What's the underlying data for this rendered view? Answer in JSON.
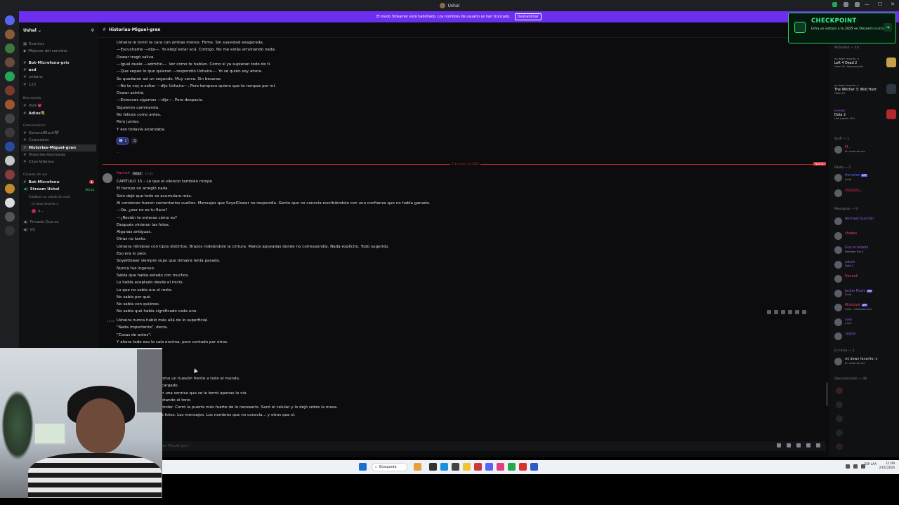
{
  "window": {
    "title": "Ushal"
  },
  "banner": {
    "text": "El modo Streamer está habilitado. Los nombres de usuario se han truncado.",
    "button": "Deshabilitar"
  },
  "server": {
    "name": "Ushal",
    "chevron": "⌄"
  },
  "sidebar": {
    "items": [
      {
        "label": "Eventos",
        "type": "link"
      },
      {
        "label": "Mejoras del servidor",
        "type": "link"
      },
      {
        "label": "Bot-Microfono-priv",
        "type": "text",
        "bold": true
      },
      {
        "label": "asd",
        "type": "text",
        "bold": true
      },
      {
        "label": "unbanz",
        "type": "text"
      },
      {
        "label": "123",
        "type": "text"
      }
    ],
    "categories": [
      {
        "label": "Bienvenida",
        "channels": [
          "Holi-💗",
          "Adios💐"
        ]
      },
      {
        "label": "Comunicacion",
        "channels": [
          "GeneralBlack🖤",
          "Comandos",
          "Historias-Miguel-gran",
          "Historias-Guimaida",
          "Clips-Videoss"
        ]
      },
      {
        "label": "Canales de voz",
        "channels": [
          "Bot-Microfono",
          "Stream Ushal"
        ]
      }
    ],
    "voice_status": "Establece un estado de canal",
    "voice_user": "mi down favorito :v",
    "voice_user2": "u...",
    "voice_time": "36:14",
    "private": "Privado Dus-ce",
    "vs": "VS",
    "badge": "1"
  },
  "chat": {
    "channel": "Historias-Miguel-gran",
    "lines_top": [
      "Ushaira le tomó la cara con ambas manos. Firme. Sin suavidad exagerada.",
      "—Escuchame —dijo—. Yo elegí estar acá. Contigo. No me estás arruinando nada.",
      "Oswar tragó saliva.",
      "—Igual duele —admitió—. Ver cómo te hablan. Como si ya supieran todo de ti.",
      "—Que sepan lo que quieran —respondió Ushaira—. Yo sé quién soy ahora.",
      "Se quedaron así un segundo. Muy cerca. Sin besarse.",
      "—No te voy a soltar —dijo Ushaira—. Pero tampoco quiero que te rompas por mí.",
      "Oswar asintió.",
      "—Entonces sigamos —dijo—. Pero despacio.",
      "Siguieron caminando.",
      "No felices como antes.",
      "Pero juntos.",
      "Y eso todavía alcanzaba."
    ],
    "reaction_count": "1",
    "dotdot": "..",
    "new_label": "NUEVO",
    "new_date": "2 de enero de 2026",
    "msg_author": "Hannah",
    "msg_tag": "WOLF",
    "msg_time": "11:02",
    "lines_msg": [
      "CAPÍTULO 15 – Lo que el silencio también rompe",
      "El tiempo no arregló nada.",
      "Solo dejó que todo se acumulara más.",
      "Al comienzo fueron comentarios sueltos. Mensajes que SoyelOswar no respondía. Gente que no conocía escribiéndole con una confianza que no había ganado.",
      "—Oe, ¿ese no es tu flaco?",
      "—¿Recién te enteras cómo es?",
      "Después vinieron las fotos.",
      "Algunas antiguas.",
      "Otras no tanto.",
      "Ushaira riéndose con tipos distintos. Brazos rodeándole la cintura. Manos apoyadas donde no correspondía. Nada explícito. Todo sugerido.",
      "Eso era lo peor.",
      "SoyelOswar siempre supo que Ushaira tenía pasado.",
      "Nunca fue ingenuo.",
      "Sabía que había estado con muchos.",
      "Lo había aceptado desde el inicio.",
      "Lo que no sabía era el resto.",
      "No sabía por qué.",
      "No sabía con quiénes.",
      "No sabía qué había significado cada uno."
    ],
    "followup_time": "11:02",
    "lines_follow": [
      "Ushaira nunca habló más allá de lo superficial.",
      "\"Nada importante\", decía.",
      "\"Cosas de antes\".",
      "Y ahora todo eso le caía encima, pero contado por otros."
    ],
    "lines_partial": [
      "omo un huevón frente a todo el mundo.",
      "cargado.",
      "n una sonrisa que se le borró apenas lo vio.",
      "ptando el tono.",
      "onder. Cerró la puerta más fuerte de lo necesario. Sacó el celular y lo dejó sobre la mesa.",
      "s fotos. Los mensajes. Los nombres que no conocía… y otros que sí."
    ],
    "input_placeholder": "ias-Miguel-gran"
  },
  "checkpoint": {
    "title": "CHECKPOINT",
    "subtitle": "Echa un vistazo a tu 2025 en Discord",
    "link": "(ocultar)"
  },
  "members": {
    "activity_header": "Actividad — 10",
    "activity": [
      {
        "head": "mi down favorito :v",
        "game": "Left 4 Dead 2",
        "sub": "Hace 1d · Resurrección",
        "color": "#c5a14a"
      },
      {
        "head": "mi down favorito :v",
        "game": "The Witcher 3: Wild Hunt",
        "sub": "Hace 1d",
        "color": "#2d3540"
      },
      {
        "head": "BOMBER",
        "game": "Dota 2",
        "sub": "Has jugado 16 h",
        "color": "#b3282d"
      }
    ],
    "staff_header": "Staff — 1",
    "staff": [
      {
        "name": "M...",
        "status": "En canal de voz",
        "color": "#e03f6a"
      }
    ],
    "pilota_header": "Pilota — 2",
    "pilota": [
      {
        "name": "Homelan",
        "status": "/help",
        "app": "APP",
        "color": "#5865f2"
      },
      {
        "name": "PINGBALL",
        "status": "",
        "app": "",
        "color": "#c0245a"
      }
    ],
    "miembros_header": "Miembros — 9",
    "miembros": [
      {
        "name": "Abimael Guzmán",
        "status": "",
        "app": "",
        "color": "#8e59d9"
      },
      {
        "name": "chabes",
        "status": "",
        "app": "",
        "color": "#e03f6a"
      },
      {
        "name": "Guy el estado",
        "status": "Resident Evil 4",
        "app": "",
        "color": "#8e59d9"
      },
      {
        "name": "edurb",
        "status": "Dota 2",
        "app": "",
        "color": "#8e59d9"
      },
      {
        "name": "Hannah",
        "status": "",
        "app": "",
        "color": "#e03f6a"
      },
      {
        "name": "Jockie Music",
        "status": "/help",
        "app": "APP",
        "color": "#8e59d9"
      },
      {
        "name": "Mimicbot",
        "status": "/help · mimicbot.com",
        "app": "APP",
        "color": "#e03f6a"
      },
      {
        "name": "xavi",
        "status": "u bro",
        "app": "",
        "color": "#8e59d9"
      },
      {
        "name": "zaytas",
        "status": "",
        "app": "",
        "color": "#8e59d9"
      }
    ],
    "online_header": "En línea — 1",
    "online": [
      {
        "name": "mi down favorito :v",
        "status": "En canal de voz",
        "color": "#dbdee1"
      }
    ],
    "offline_header": "Desconectado — 49"
  },
  "taskbar": {
    "search": "Búsqueda",
    "clock": "11:09",
    "date": "2/01/2026",
    "lang": "ESP LAA"
  },
  "colors": {
    "accent": "#5865f2",
    "banner": "#6c2ff0",
    "checkpoint": "#23d160",
    "new_divider": "#d83c3e"
  }
}
